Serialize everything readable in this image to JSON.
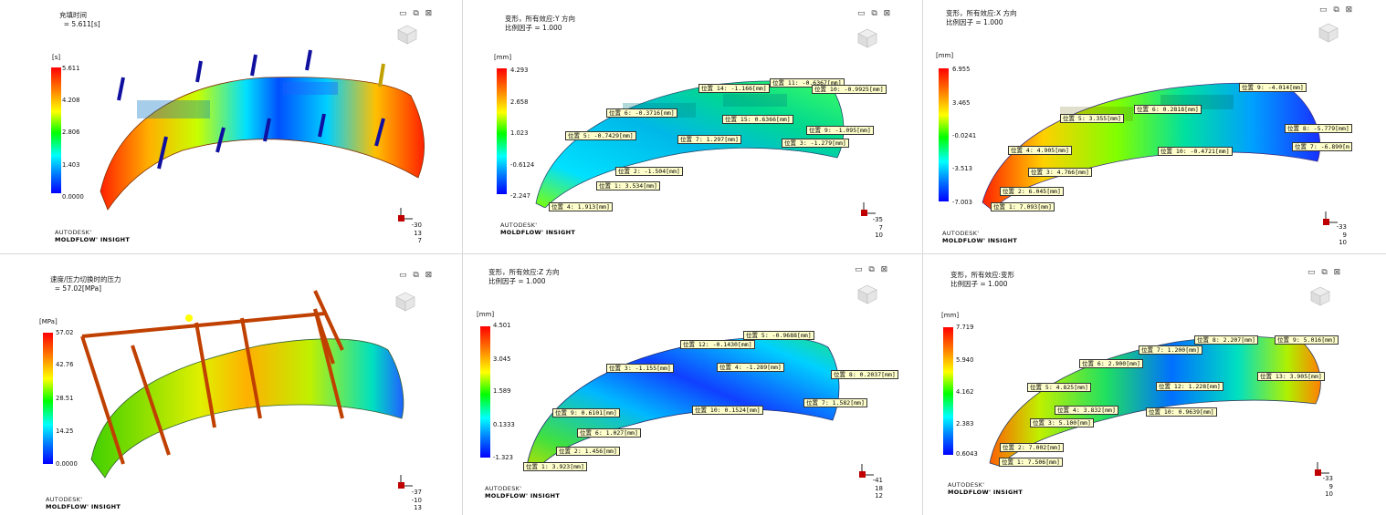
{
  "window_controls": "▭ ⧉ ⊠",
  "brand": {
    "line1": "AUTODESK'",
    "line2": "MOLDFLOW' INSIGHT"
  },
  "panels": [
    {
      "id": "p1",
      "title": "充填时间\n  = 5.611[s]",
      "unit": "[s]",
      "ticks": [
        "5.611",
        "4.208",
        "2.806",
        "1.403",
        "0.0000"
      ],
      "rotation": [
        "-30",
        "13",
        "7"
      ],
      "labels": []
    },
    {
      "id": "p2",
      "title": "变形，所有效应:Y 方向\n比例因子 = 1.000",
      "unit": "[mm]",
      "ticks": [
        "4.293",
        "2.658",
        "1.023",
        "-0.6124",
        "-2.247"
      ],
      "rotation": [
        "-35",
        "7",
        "10"
      ],
      "labels": [
        "位置 11: -0.6367[mm]",
        "位置 14: -1.166[mm]",
        "位置 10: -0.9925[mm]",
        "位置 6: -0.3716[mm]",
        "位置 15: 0.6366[mm]",
        "位置 5: -0.7429[mm]",
        "位置 7: 1.297[mm]",
        "位置 9: -1.095[mm]",
        "位置 3: -1.279[mm]",
        "位置 2: -1.504[mm]",
        "位置 1: 3.534[mm]",
        "位置 4: 1.913[mm]"
      ]
    },
    {
      "id": "p3",
      "title": "变形，所有效应:X 方向\n比例因子 = 1.000",
      "unit": "[mm]",
      "ticks": [
        "6.955",
        "3.465",
        "-0.0241",
        "-3.513",
        "-7.003"
      ],
      "rotation": [
        "-33",
        "9",
        "10"
      ],
      "labels": [
        "位置 9: -4.014[mm]",
        "位置 5: 3.355[mm]",
        "位置 6: 0.2818[mm]",
        "位置 8: -5.779[mm]",
        "位置 4: 4.905[mm]",
        "位置 10: -0.4721[mm]",
        "位置 7: -6.890[m",
        "位置 3: 4.766[mm]",
        "位置 2: 6.045[mm]",
        "位置 1: 7.093[mm]"
      ]
    },
    {
      "id": "p4",
      "title": "速度/压力切换时的压力\n  = 57.02[MPa]",
      "unit": "[MPa]",
      "ticks": [
        "57.02",
        "42.76",
        "28.51",
        "14.25",
        "0.0000"
      ],
      "rotation": [
        "-37",
        "-10",
        "13"
      ],
      "labels": []
    },
    {
      "id": "p5",
      "title": "变形，所有效应:Z 方向\n比例因子 = 1.000",
      "unit": "[mm]",
      "ticks": [
        "4.501",
        "3.045",
        "1.589",
        "0.1333",
        "-1.323"
      ],
      "rotation": [
        "-41",
        "18",
        "12"
      ],
      "labels": [
        "位置 5: -0.9688[mm]",
        "位置 12: -0.1430[mm]",
        "位置 3: -1.155[mm]",
        "位置 4: -1.289[mm]",
        "位置 8: 0.2037[mm]",
        "位置 7: 1.582[mm]",
        "位置 9: 0.6101[mm]",
        "位置 10: 0.1524[mm]",
        "位置 6: 1.027[mm]",
        "位置 2: 1.456[mm]",
        "位置 1: 3.923[mm]"
      ]
    },
    {
      "id": "p6",
      "title": "变形，所有效应:变形\n比例因子 = 1.000",
      "unit": "[mm]",
      "ticks": [
        "7.719",
        "5.940",
        "4.162",
        "2.383",
        "0.6043"
      ],
      "rotation": [
        "-33",
        "9",
        "10"
      ],
      "labels": [
        "位置 8: 2.207[mm]",
        "位置 9: 5.016[mm]",
        "位置 7: 1.200[mm]",
        "位置 6: 2.900[mm]",
        "位置 13: 3.905[mm]",
        "位置 5: 4.825[mm]",
        "位置 12: 1.228[mm]",
        "位置 4: 3.832[mm]",
        "位置 10: 0.9639[mm]",
        "位置 3: 5.100[mm]",
        "位置 2: 7.002[mm]",
        "位置 1: 7.506[mm]"
      ]
    }
  ]
}
